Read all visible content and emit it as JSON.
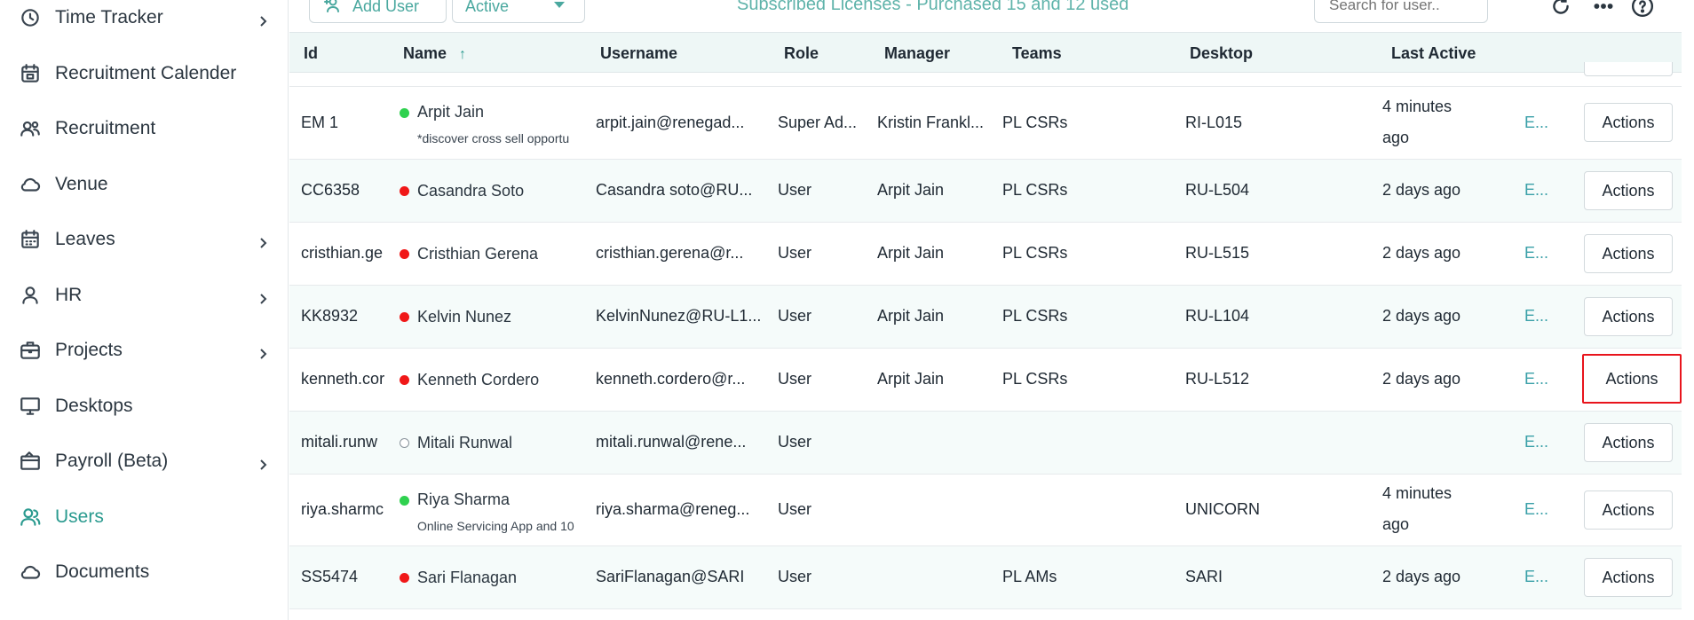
{
  "sidebar": {
    "items": [
      {
        "label": "Time Tracker",
        "icon": "timer-icon",
        "chevron": true
      },
      {
        "label": "Recruitment Calender",
        "icon": "calendar-icon",
        "chevron": false
      },
      {
        "label": "Recruitment",
        "icon": "people-icon",
        "chevron": false
      },
      {
        "label": "Venue",
        "icon": "cloud-icon",
        "chevron": false
      },
      {
        "label": "Leaves",
        "icon": "calendar-grid-icon",
        "chevron": true
      },
      {
        "label": "HR",
        "icon": "person-icon",
        "chevron": true
      },
      {
        "label": "Projects",
        "icon": "briefcase-icon",
        "chevron": true
      },
      {
        "label": "Desktops",
        "icon": "monitor-icon",
        "chevron": false
      },
      {
        "label": "Payroll (Beta)",
        "icon": "wallet-icon",
        "chevron": true
      },
      {
        "label": "Users",
        "icon": "users-icon",
        "chevron": false,
        "active": true
      },
      {
        "label": "Documents",
        "icon": "cloud-icon",
        "chevron": false
      }
    ]
  },
  "toolbar": {
    "add_user": "Add User",
    "status_filter": "Active",
    "licenses": "Subscribed Licenses - Purchased 15 and 12 used",
    "search_placeholder": "Search for user.."
  },
  "table": {
    "headers": {
      "id": "Id",
      "name": "Name",
      "username": "Username",
      "role": "Role",
      "manager": "Manager",
      "teams": "Teams",
      "desktop": "Desktop",
      "last_active": "Last Active"
    },
    "actions_label": "Actions",
    "edit_label": "E...",
    "rows": [
      {
        "id": "EM 1",
        "status": "green",
        "name": "Arpit Jain",
        "note": "*discover cross sell opportu",
        "username": "arpit.jain@renegad...",
        "role": "Super Ad...",
        "manager": "Kristin Frankl...",
        "teams": "PL CSRs",
        "desktop": "RI-L015",
        "last_active_1": "4 minutes",
        "last_active_2": "ago"
      },
      {
        "id": "CC6358",
        "status": "red",
        "name": "Casandra Soto",
        "note": "",
        "username": "Casandra soto@RU...",
        "role": "User",
        "manager": "Arpit Jain",
        "teams": "PL CSRs",
        "desktop": "RU-L504",
        "last_active_1": "2 days ago",
        "last_active_2": ""
      },
      {
        "id": "cristhian.ge",
        "status": "red",
        "name": "Cristhian Gerena",
        "note": "",
        "username": "cristhian.gerena@r...",
        "role": "User",
        "manager": "Arpit Jain",
        "teams": "PL CSRs",
        "desktop": "RU-L515",
        "last_active_1": "2 days ago",
        "last_active_2": ""
      },
      {
        "id": "KK8932",
        "status": "red",
        "name": "Kelvin Nunez",
        "note": "",
        "username": "KelvinNunez@RU-L1...",
        "role": "User",
        "manager": "Arpit Jain",
        "teams": "PL CSRs",
        "desktop": "RU-L104",
        "last_active_1": "2 days ago",
        "last_active_2": ""
      },
      {
        "id": "kenneth.cor",
        "status": "red",
        "name": "Kenneth Cordero",
        "note": "",
        "username": "kenneth.cordero@r...",
        "role": "User",
        "manager": "Arpit Jain",
        "teams": "PL CSRs",
        "desktop": "RU-L512",
        "last_active_1": "2 days ago",
        "last_active_2": ""
      },
      {
        "id": "mitali.runw",
        "status": "offline",
        "name": "Mitali Runwal",
        "note": "",
        "username": "mitali.runwal@rene...",
        "role": "User",
        "manager": "",
        "teams": "",
        "desktop": "",
        "last_active_1": "",
        "last_active_2": ""
      },
      {
        "id": "riya.sharmc",
        "status": "green",
        "name": "Riya Sharma",
        "note": "Online Servicing App and 10",
        "username": "riya.sharma@reneg...",
        "role": "User",
        "manager": "",
        "teams": "",
        "desktop": "UNICORN",
        "last_active_1": "4 minutes",
        "last_active_2": "ago"
      },
      {
        "id": "SS5474",
        "status": "red",
        "name": "Sari Flanagan",
        "note": "",
        "username": "SariFlanagan@SARI",
        "role": "User",
        "manager": "",
        "teams": "PL AMs",
        "desktop": "SARI",
        "last_active_1": "2 days ago",
        "last_active_2": ""
      }
    ]
  }
}
